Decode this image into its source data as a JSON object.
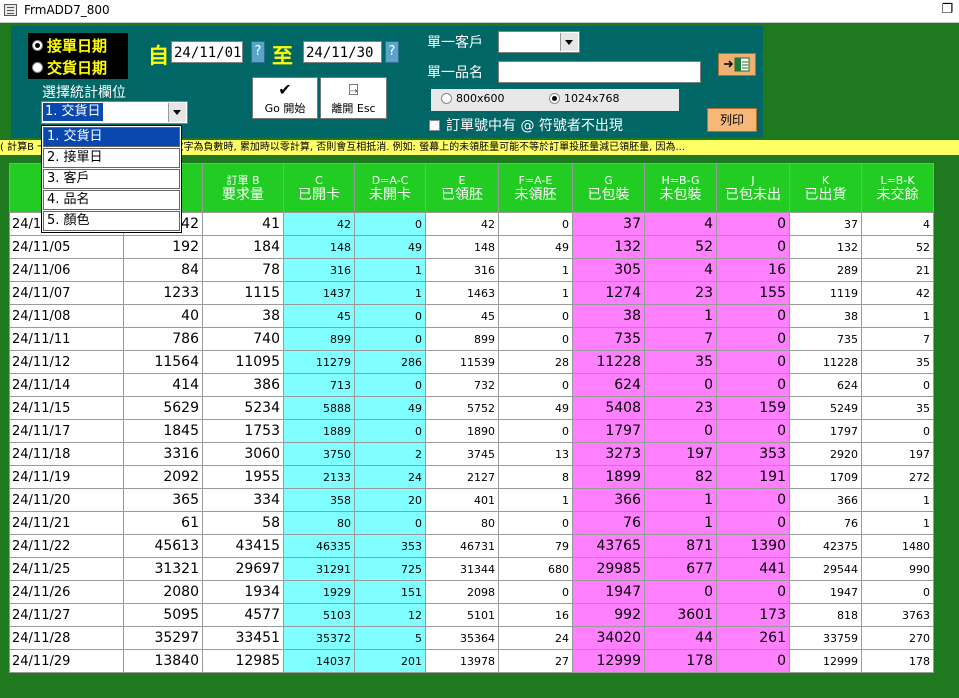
{
  "window": {
    "title": "FrmADD7_800"
  },
  "filters": {
    "radio_order_date": "接單日期",
    "radio_delivery_date": "交貨日期",
    "from_char": "自",
    "to_char": "至",
    "date_from": "24/11/01",
    "date_to": "24/11/30",
    "help_glyph": "?",
    "stat_field_label": "選擇統計欄位",
    "stat_field_value": "1. 交貨日",
    "customer_label": "單一客戶",
    "customer_value": "",
    "product_label": "單一品名",
    "product_value": "",
    "go_button": "Go 開始",
    "esc_button": "離開 Esc",
    "res_800": "800x600",
    "res_1024": "1024x768",
    "checkbox_label": "訂單號中有 @ 符號者不出現",
    "print_button": "列印"
  },
  "dropdown_options": [
    "1. 交貨日",
    "2. 接單日",
    "3. 客戶",
    "4. 品名",
    "5. 顏色"
  ],
  "note": "( 計算B 一品名的某一顏色, 若單筆某項數字為負數時, 累加時以零計算, 否則會互相抵消. 例如: 螢幕上的未領胚量可能不等於訂單投胚量減已領胚量, 因為...",
  "columns": [
    {
      "code": "",
      "name": ""
    },
    {
      "code": "A",
      "name": "量"
    },
    {
      "code": "訂單 B",
      "name": "要求量"
    },
    {
      "code": "C",
      "name": "已開卡"
    },
    {
      "code": "D=A-C",
      "name": "未開卡"
    },
    {
      "code": "E",
      "name": "已領胚"
    },
    {
      "code": "F=A-E",
      "name": "未領胚"
    },
    {
      "code": "G",
      "name": "已包裝"
    },
    {
      "code": "H=B-G",
      "name": "未包裝"
    },
    {
      "code": "J",
      "name": "已包未出"
    },
    {
      "code": "K",
      "name": "已出貨"
    },
    {
      "code": "L=B-K",
      "name": "未交餘"
    }
  ],
  "rows": [
    [
      "24/11/01",
      "42",
      "41",
      "42",
      "0",
      "42",
      "0",
      "37",
      "4",
      "0",
      "37",
      "4"
    ],
    [
      "24/11/05",
      "192",
      "184",
      "148",
      "49",
      "148",
      "49",
      "132",
      "52",
      "0",
      "132",
      "52"
    ],
    [
      "24/11/06",
      "84",
      "78",
      "316",
      "1",
      "316",
      "1",
      "305",
      "4",
      "16",
      "289",
      "21"
    ],
    [
      "24/11/07",
      "1233",
      "1115",
      "1437",
      "1",
      "1463",
      "1",
      "1274",
      "23",
      "155",
      "1119",
      "42"
    ],
    [
      "24/11/08",
      "40",
      "38",
      "45",
      "0",
      "45",
      "0",
      "38",
      "1",
      "0",
      "38",
      "1"
    ],
    [
      "24/11/11",
      "786",
      "740",
      "899",
      "0",
      "899",
      "0",
      "735",
      "7",
      "0",
      "735",
      "7"
    ],
    [
      "24/11/12",
      "11564",
      "11095",
      "11279",
      "286",
      "11539",
      "28",
      "11228",
      "35",
      "0",
      "11228",
      "35"
    ],
    [
      "24/11/14",
      "414",
      "386",
      "713",
      "0",
      "732",
      "0",
      "624",
      "0",
      "0",
      "624",
      "0"
    ],
    [
      "24/11/15",
      "5629",
      "5234",
      "5888",
      "49",
      "5752",
      "49",
      "5408",
      "23",
      "159",
      "5249",
      "35"
    ],
    [
      "24/11/17",
      "1845",
      "1753",
      "1889",
      "0",
      "1890",
      "0",
      "1797",
      "0",
      "0",
      "1797",
      "0"
    ],
    [
      "24/11/18",
      "3316",
      "3060",
      "3750",
      "2",
      "3745",
      "13",
      "3273",
      "197",
      "353",
      "2920",
      "197"
    ],
    [
      "24/11/19",
      "2092",
      "1955",
      "2133",
      "24",
      "2127",
      "8",
      "1899",
      "82",
      "191",
      "1709",
      "272"
    ],
    [
      "24/11/20",
      "365",
      "334",
      "358",
      "20",
      "401",
      "1",
      "366",
      "1",
      "0",
      "366",
      "1"
    ],
    [
      "24/11/21",
      "61",
      "58",
      "80",
      "0",
      "80",
      "0",
      "76",
      "1",
      "0",
      "76",
      "1"
    ],
    [
      "24/11/22",
      "45613",
      "43415",
      "46335",
      "353",
      "46731",
      "79",
      "43765",
      "871",
      "1390",
      "42375",
      "1480"
    ],
    [
      "24/11/25",
      "31321",
      "29697",
      "31291",
      "725",
      "31344",
      "680",
      "29985",
      "677",
      "441",
      "29544",
      "990"
    ],
    [
      "24/11/26",
      "2080",
      "1934",
      "1929",
      "151",
      "2098",
      "0",
      "1947",
      "0",
      "0",
      "1947",
      "0"
    ],
    [
      "24/11/27",
      "5095",
      "4577",
      "5103",
      "12",
      "5101",
      "16",
      "992",
      "3601",
      "173",
      "818",
      "3763"
    ],
    [
      "24/11/28",
      "35297",
      "33451",
      "35372",
      "5",
      "35364",
      "24",
      "34020",
      "44",
      "261",
      "33759",
      "270"
    ],
    [
      "24/11/29",
      "13840",
      "12985",
      "14037",
      "201",
      "13978",
      "27",
      "12999",
      "178",
      "0",
      "12999",
      "178"
    ]
  ]
}
